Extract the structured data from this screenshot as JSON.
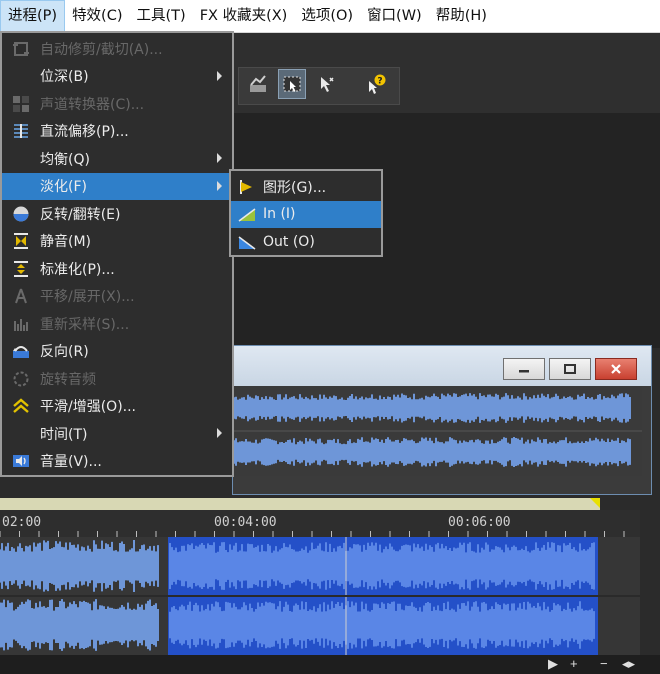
{
  "menubar": {
    "items": [
      {
        "label": "进程(P)",
        "active": true
      },
      {
        "label": "特效(C)"
      },
      {
        "label": "工具(T)"
      },
      {
        "label": "FX 收藏夹(X)"
      },
      {
        "label": "选项(O)"
      },
      {
        "label": "窗口(W)"
      },
      {
        "label": "帮助(H)"
      }
    ]
  },
  "process_menu": {
    "items": [
      {
        "label": "自动修剪/截切(A)...",
        "icon": "auto-trim-icon",
        "disabled": true
      },
      {
        "label": "位深(B)",
        "icon": "",
        "submenu": true
      },
      {
        "label": "声道转换器(C)...",
        "icon": "channel-converter-icon",
        "disabled": true
      },
      {
        "label": "直流偏移(P)...",
        "icon": "dc-offset-icon"
      },
      {
        "label": "均衡(Q)",
        "icon": "",
        "submenu": true
      },
      {
        "label": "淡化(F)",
        "icon": "",
        "submenu": true,
        "selected": true
      },
      {
        "label": "反转/翻转(E)",
        "icon": "invert-icon"
      },
      {
        "label": "静音(M)",
        "icon": "mute-icon"
      },
      {
        "label": "标准化(P)...",
        "icon": "normalize-icon"
      },
      {
        "label": "平移/展开(X)...",
        "icon": "pan-expand-icon",
        "disabled": true
      },
      {
        "label": "重新采样(S)...",
        "icon": "resample-icon",
        "disabled": true
      },
      {
        "label": "反向(R)",
        "icon": "reverse-icon"
      },
      {
        "label": "旋转音频",
        "icon": "rotate-audio-icon",
        "disabled": true
      },
      {
        "label": "平滑/增强(O)...",
        "icon": "smooth-enhance-icon"
      },
      {
        "label": "时间(T)",
        "icon": "",
        "submenu": true
      },
      {
        "label": "音量(V)...",
        "icon": "volume-icon"
      }
    ]
  },
  "fade_submenu": {
    "items": [
      {
        "label": "图形(G)...",
        "icon": "graphic-fade-icon"
      },
      {
        "label": "In (I)",
        "icon": "fade-in-icon",
        "selected": true
      },
      {
        "label": "Out (O)",
        "icon": "fade-out-icon"
      }
    ]
  },
  "timeline": {
    "labels": [
      "02:00",
      "00:04:00",
      "00:06:00"
    ]
  },
  "bottombar": {
    "controls": [
      "▶",
      "+",
      "−",
      "◂▸"
    ]
  },
  "colors": {
    "accent": "#2f7fc9",
    "wave_light": "#6e96d8",
    "wave_selected": "#2d5fd6"
  }
}
